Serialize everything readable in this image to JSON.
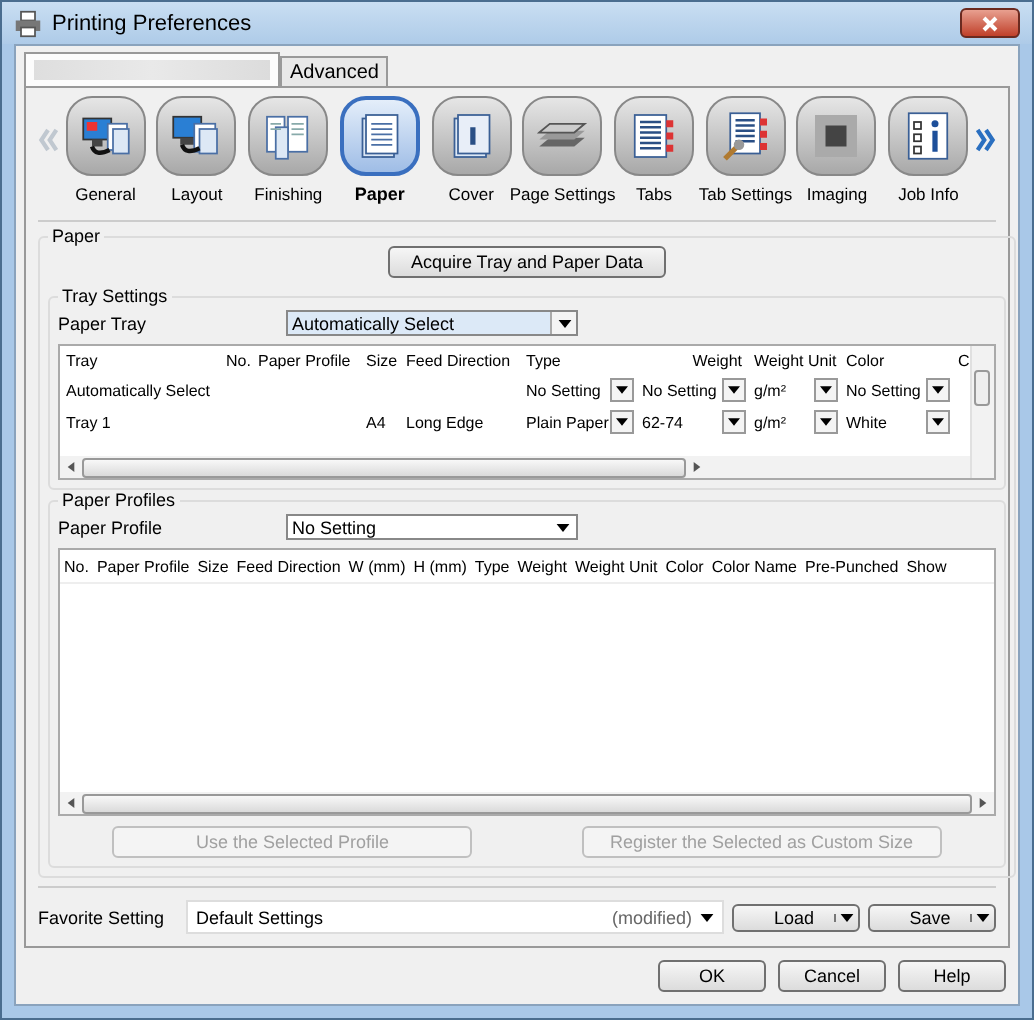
{
  "window": {
    "title": "Printing Preferences"
  },
  "tabs": [
    {
      "redacted": true,
      "selected": true
    },
    {
      "label": "Advanced",
      "selected": false
    }
  ],
  "nav": [
    {
      "label": "General",
      "kind": "general",
      "selected": false
    },
    {
      "label": "Layout",
      "kind": "layout",
      "selected": false
    },
    {
      "label": "Finishing",
      "kind": "finishing",
      "selected": false
    },
    {
      "label": "Paper",
      "kind": "paper",
      "selected": true
    },
    {
      "label": "Cover",
      "kind": "cover",
      "selected": false
    },
    {
      "label": "Page Settings",
      "kind": "stack",
      "selected": false
    },
    {
      "label": "Tabs",
      "kind": "tabs",
      "selected": false
    },
    {
      "label": "Tab Settings",
      "kind": "tab-settings",
      "selected": false
    },
    {
      "label": "Imaging",
      "kind": "imaging",
      "selected": false
    },
    {
      "label": "Job Info",
      "kind": "info",
      "selected": false
    }
  ],
  "paper": {
    "title": "Paper",
    "acquire_button": "Acquire Tray and Paper Data",
    "tray_settings": {
      "title": "Tray Settings",
      "paper_tray": {
        "label": "Paper Tray",
        "value": "Automatically Select"
      },
      "table": {
        "columns": [
          "Tray",
          "No.",
          "Paper Profile",
          "Size",
          "Feed Direction",
          "Type",
          "Weight",
          "Weight Unit",
          "Color",
          "C"
        ],
        "rows": [
          {
            "cells": [
              {
                "text": "Automatically Select"
              },
              {},
              {},
              {},
              {},
              {
                "text": "No Setting",
                "dropdown": true
              },
              {
                "text": "No Setting",
                "dropdown": true
              },
              {
                "text": "g/m²",
                "dropdown": true
              },
              {
                "text": "No Setting",
                "dropdown": true
              },
              {}
            ]
          },
          {
            "cells": [
              {
                "text": "Tray 1"
              },
              {},
              {},
              {
                "text": "A4"
              },
              {
                "text": "Long Edge"
              },
              {
                "text": "Plain Paper",
                "dropdown": true
              },
              {
                "text": "62-74",
                "dropdown": true
              },
              {
                "text": "g/m²",
                "dropdown": true
              },
              {
                "text": "White",
                "dropdown": true
              },
              {}
            ]
          }
        ]
      }
    },
    "paper_profiles": {
      "title": "Paper Profiles",
      "paper_profile": {
        "label": "Paper Profile",
        "value": "No Setting"
      },
      "table": {
        "columns": [
          "No.",
          "Paper Profile",
          "Size",
          "Feed Direction",
          "W (mm)",
          "H (mm)",
          "Type",
          "Weight",
          "Weight Unit",
          "Color",
          "Color Name",
          "Pre-Punched",
          "Show"
        ]
      },
      "buttons": [
        {
          "label": "Use the Selected Profile",
          "disabled": true
        },
        {
          "label": "Register the Selected as Custom Size",
          "disabled": true
        }
      ]
    }
  },
  "favorite": {
    "label": "Favorite Setting",
    "value": "Default Settings",
    "status": "(modified)",
    "buttons": [
      "Load",
      "Save"
    ]
  },
  "buttons": [
    "OK",
    "Cancel",
    "Help"
  ]
}
